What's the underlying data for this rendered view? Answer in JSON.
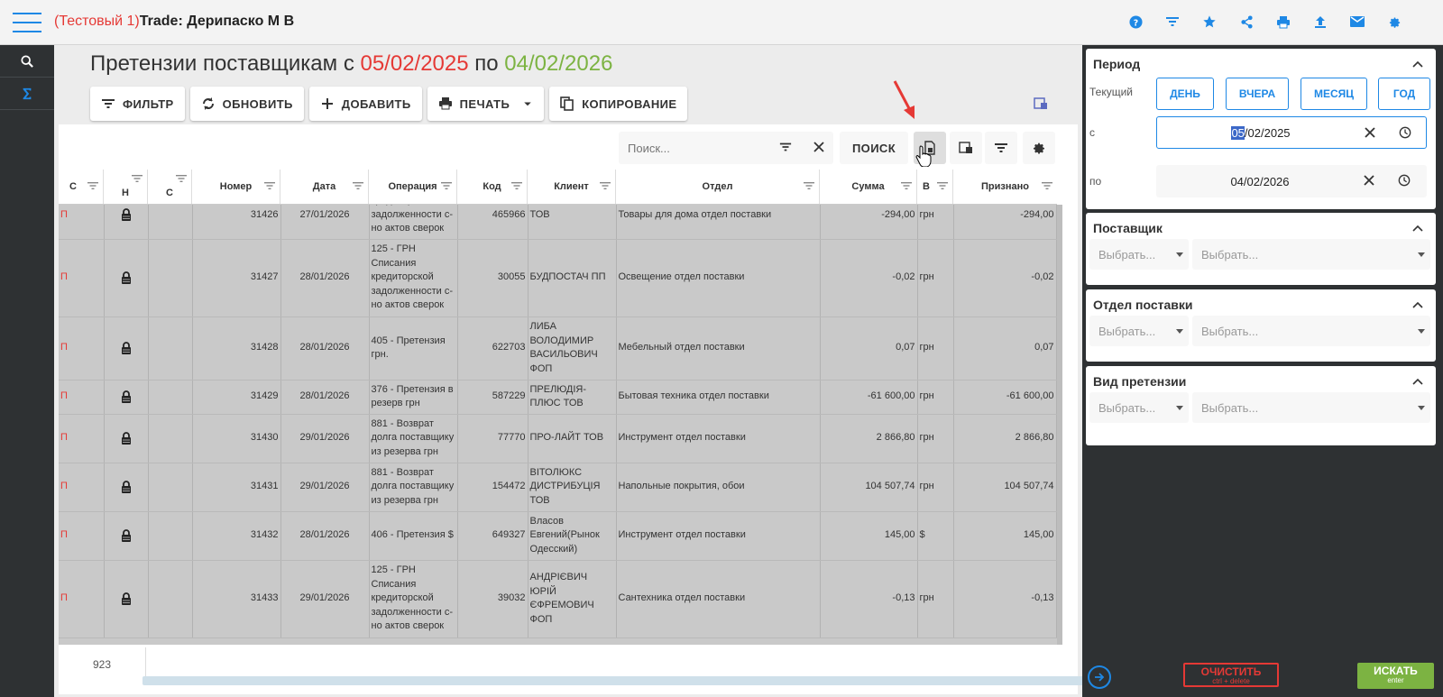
{
  "app": {
    "prefix": "(Тестовый 1)",
    "title": "Trade: Дерипаско М В"
  },
  "top_icons": [
    "help-icon",
    "filter-icon",
    "star-icon",
    "share-icon",
    "print-icon",
    "upload-icon",
    "mail-icon",
    "gear-icon"
  ],
  "page": {
    "title_prefix": "Претензии поставщикам с ",
    "date_from": "05/02/2025",
    "title_mid": " по ",
    "date_to": "04/02/2026"
  },
  "toolbar": {
    "filter": "ФИЛЬТР",
    "refresh": "ОБНОВИТЬ",
    "add": "ДОБАВИТЬ",
    "print": "ПЕЧАТЬ",
    "copy": "КОПИРОВАНИЕ"
  },
  "search": {
    "placeholder": "Поиск...",
    "button": "ПОИСК"
  },
  "columns": {
    "c1": "С",
    "h": "Н",
    "c2": "С",
    "number": "Номер",
    "date": "Дата",
    "operation": "Операция",
    "code": "Код",
    "client": "Клиент",
    "department": "Отдел",
    "sum": "Сумма",
    "currency": "В",
    "recognized": "Признано"
  },
  "rows": [
    {
      "flag": "П",
      "number": "31426",
      "date": "27/01/2026",
      "operation": "кредиторской задолженности с-но актов сверок",
      "code": "465966",
      "client": "ТОВ",
      "department": "Товары для дома отдел поставки",
      "sum": "-294,00",
      "currency": "грн",
      "recognized": "-294,00"
    },
    {
      "flag": "П",
      "number": "31427",
      "date": "28/01/2026",
      "operation": "125 - ГРН Списания кредиторской задолженности с-но актов сверок",
      "code": "30055",
      "client": "БУДПОСТАЧ ПП",
      "department": "Освещение отдел поставки",
      "sum": "-0,02",
      "currency": "грн",
      "recognized": "-0,02"
    },
    {
      "flag": "П",
      "number": "31428",
      "date": "28/01/2026",
      "operation": "405 - Претензия грн.",
      "code": "622703",
      "client": "ЛИБА ВОЛОДИМИР ВАСИЛЬОВИЧ ФОП",
      "department": "Мебельный отдел поставки",
      "sum": "0,07",
      "currency": "грн",
      "recognized": "0,07"
    },
    {
      "flag": "П",
      "number": "31429",
      "date": "28/01/2026",
      "operation": "376 - Претензия в резерв грн",
      "code": "587229",
      "client": "ПРЕЛЮДІЯ-ПЛЮС ТОВ",
      "department": "Бытовая техника отдел поставки",
      "sum": "-61 600,00",
      "currency": "грн",
      "recognized": "-61 600,00"
    },
    {
      "flag": "П",
      "number": "31430",
      "date": "29/01/2026",
      "operation": "881 - Возврат долга поставщику из резерва грн",
      "code": "77770",
      "client": "ПРО-ЛАЙТ ТОВ",
      "department": "Инструмент отдел поставки",
      "sum": "2 866,80",
      "currency": "грн",
      "recognized": "2 866,80"
    },
    {
      "flag": "П",
      "number": "31431",
      "date": "29/01/2026",
      "operation": "881 - Возврат долга поставщику из резерва грн",
      "code": "154472",
      "client": "ВІТОЛЮКС ДИСТРИБУЦІЯ ТОВ",
      "department": "Напольные покрытия, обои",
      "sum": "104 507,74",
      "currency": "грн",
      "recognized": "104 507,74"
    },
    {
      "flag": "П",
      "number": "31432",
      "date": "28/01/2026",
      "operation": "406 - Претензия $",
      "code": "649327",
      "client": "Власов Евгений(Рынок Одесский)",
      "department": "Инструмент отдел поставки",
      "sum": "145,00",
      "currency": "$",
      "recognized": "145,00"
    },
    {
      "flag": "П",
      "number": "31433",
      "date": "29/01/2026",
      "operation": "125 - ГРН Списания кредиторской задолженности с-но актов сверок",
      "code": "39032",
      "client": "АНДРІЄВИЧ ЮРІЙ ЄФРЕМОВИЧ ФОП",
      "department": "Сантехника отдел поставки",
      "sum": "-0,13",
      "currency": "грн",
      "recognized": "-0,13"
    }
  ],
  "footer": {
    "count": "923"
  },
  "right_panel": {
    "period": {
      "title": "Период",
      "current_label": "Текущий",
      "btn_day": "ДЕНЬ",
      "btn_yesterday": "ВЧЕРА",
      "btn_month": "МЕСЯЦ",
      "btn_year": "ГОД",
      "from_label": "с",
      "from_selected": "05",
      "from_rest": "/02/2025",
      "to_label": "по",
      "to_value": "04/02/2026"
    },
    "supplier": {
      "title": "Поставщик",
      "select1": "Выбрать...",
      "select2": "Выбрать..."
    },
    "department": {
      "title": "Отдел поставки",
      "select1": "Выбрать...",
      "select2": "Выбрать..."
    },
    "claim_type": {
      "title": "Вид претензии",
      "select1": "Выбрать...",
      "select2": "Выбрать..."
    }
  },
  "actions": {
    "clear": "ОЧИСТИТЬ",
    "clear_hint": "ctrl + delete",
    "search": "ИСКАТЬ",
    "search_hint": "enter"
  },
  "colors": {
    "accent": "#1e88e5",
    "danger": "#e53935",
    "success": "#7cb342",
    "sidebar": "#2e3133"
  }
}
